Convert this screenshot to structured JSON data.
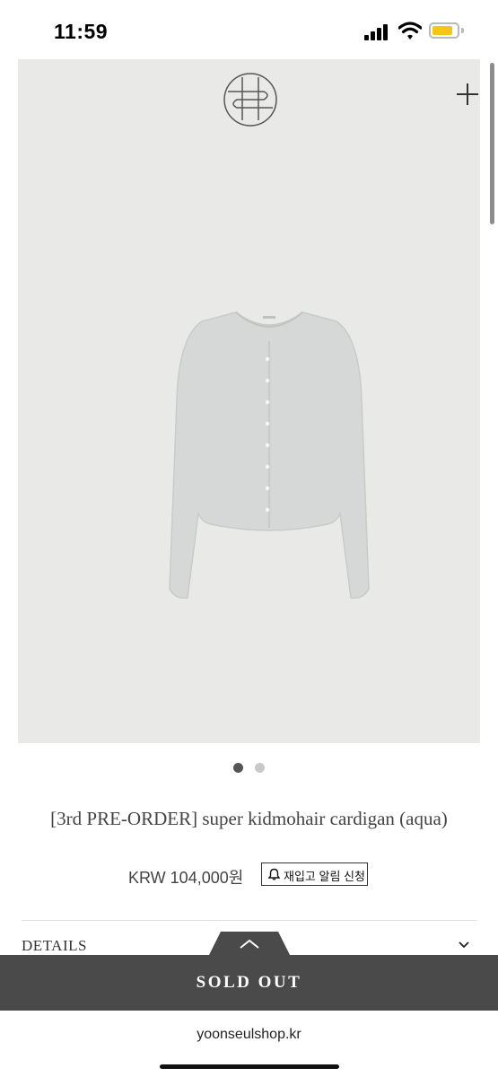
{
  "status_bar": {
    "time": "11:59"
  },
  "product": {
    "title": "[3rd PRE-ORDER] super kidmohair cardigan (aqua)",
    "price": "KRW 104,000원",
    "restock_button": "재입고 알림 신청",
    "image_pagination": {
      "total": 2,
      "current": 1
    }
  },
  "sections": {
    "details_label": "DETAILS"
  },
  "actions": {
    "sold_out_label": "SOLD OUT"
  },
  "footer": {
    "url": "yoonseulshop.kr"
  },
  "colors": {
    "image_bg": "#e9e9e7",
    "sold_out_bar": "#4a4a4a",
    "battery": "#f5c518"
  },
  "icons": [
    "signal-icon",
    "wifi-icon",
    "battery-icon",
    "brand-logo",
    "plus-icon",
    "bell-icon",
    "chevron-down-icon",
    "chevron-up-icon"
  ]
}
